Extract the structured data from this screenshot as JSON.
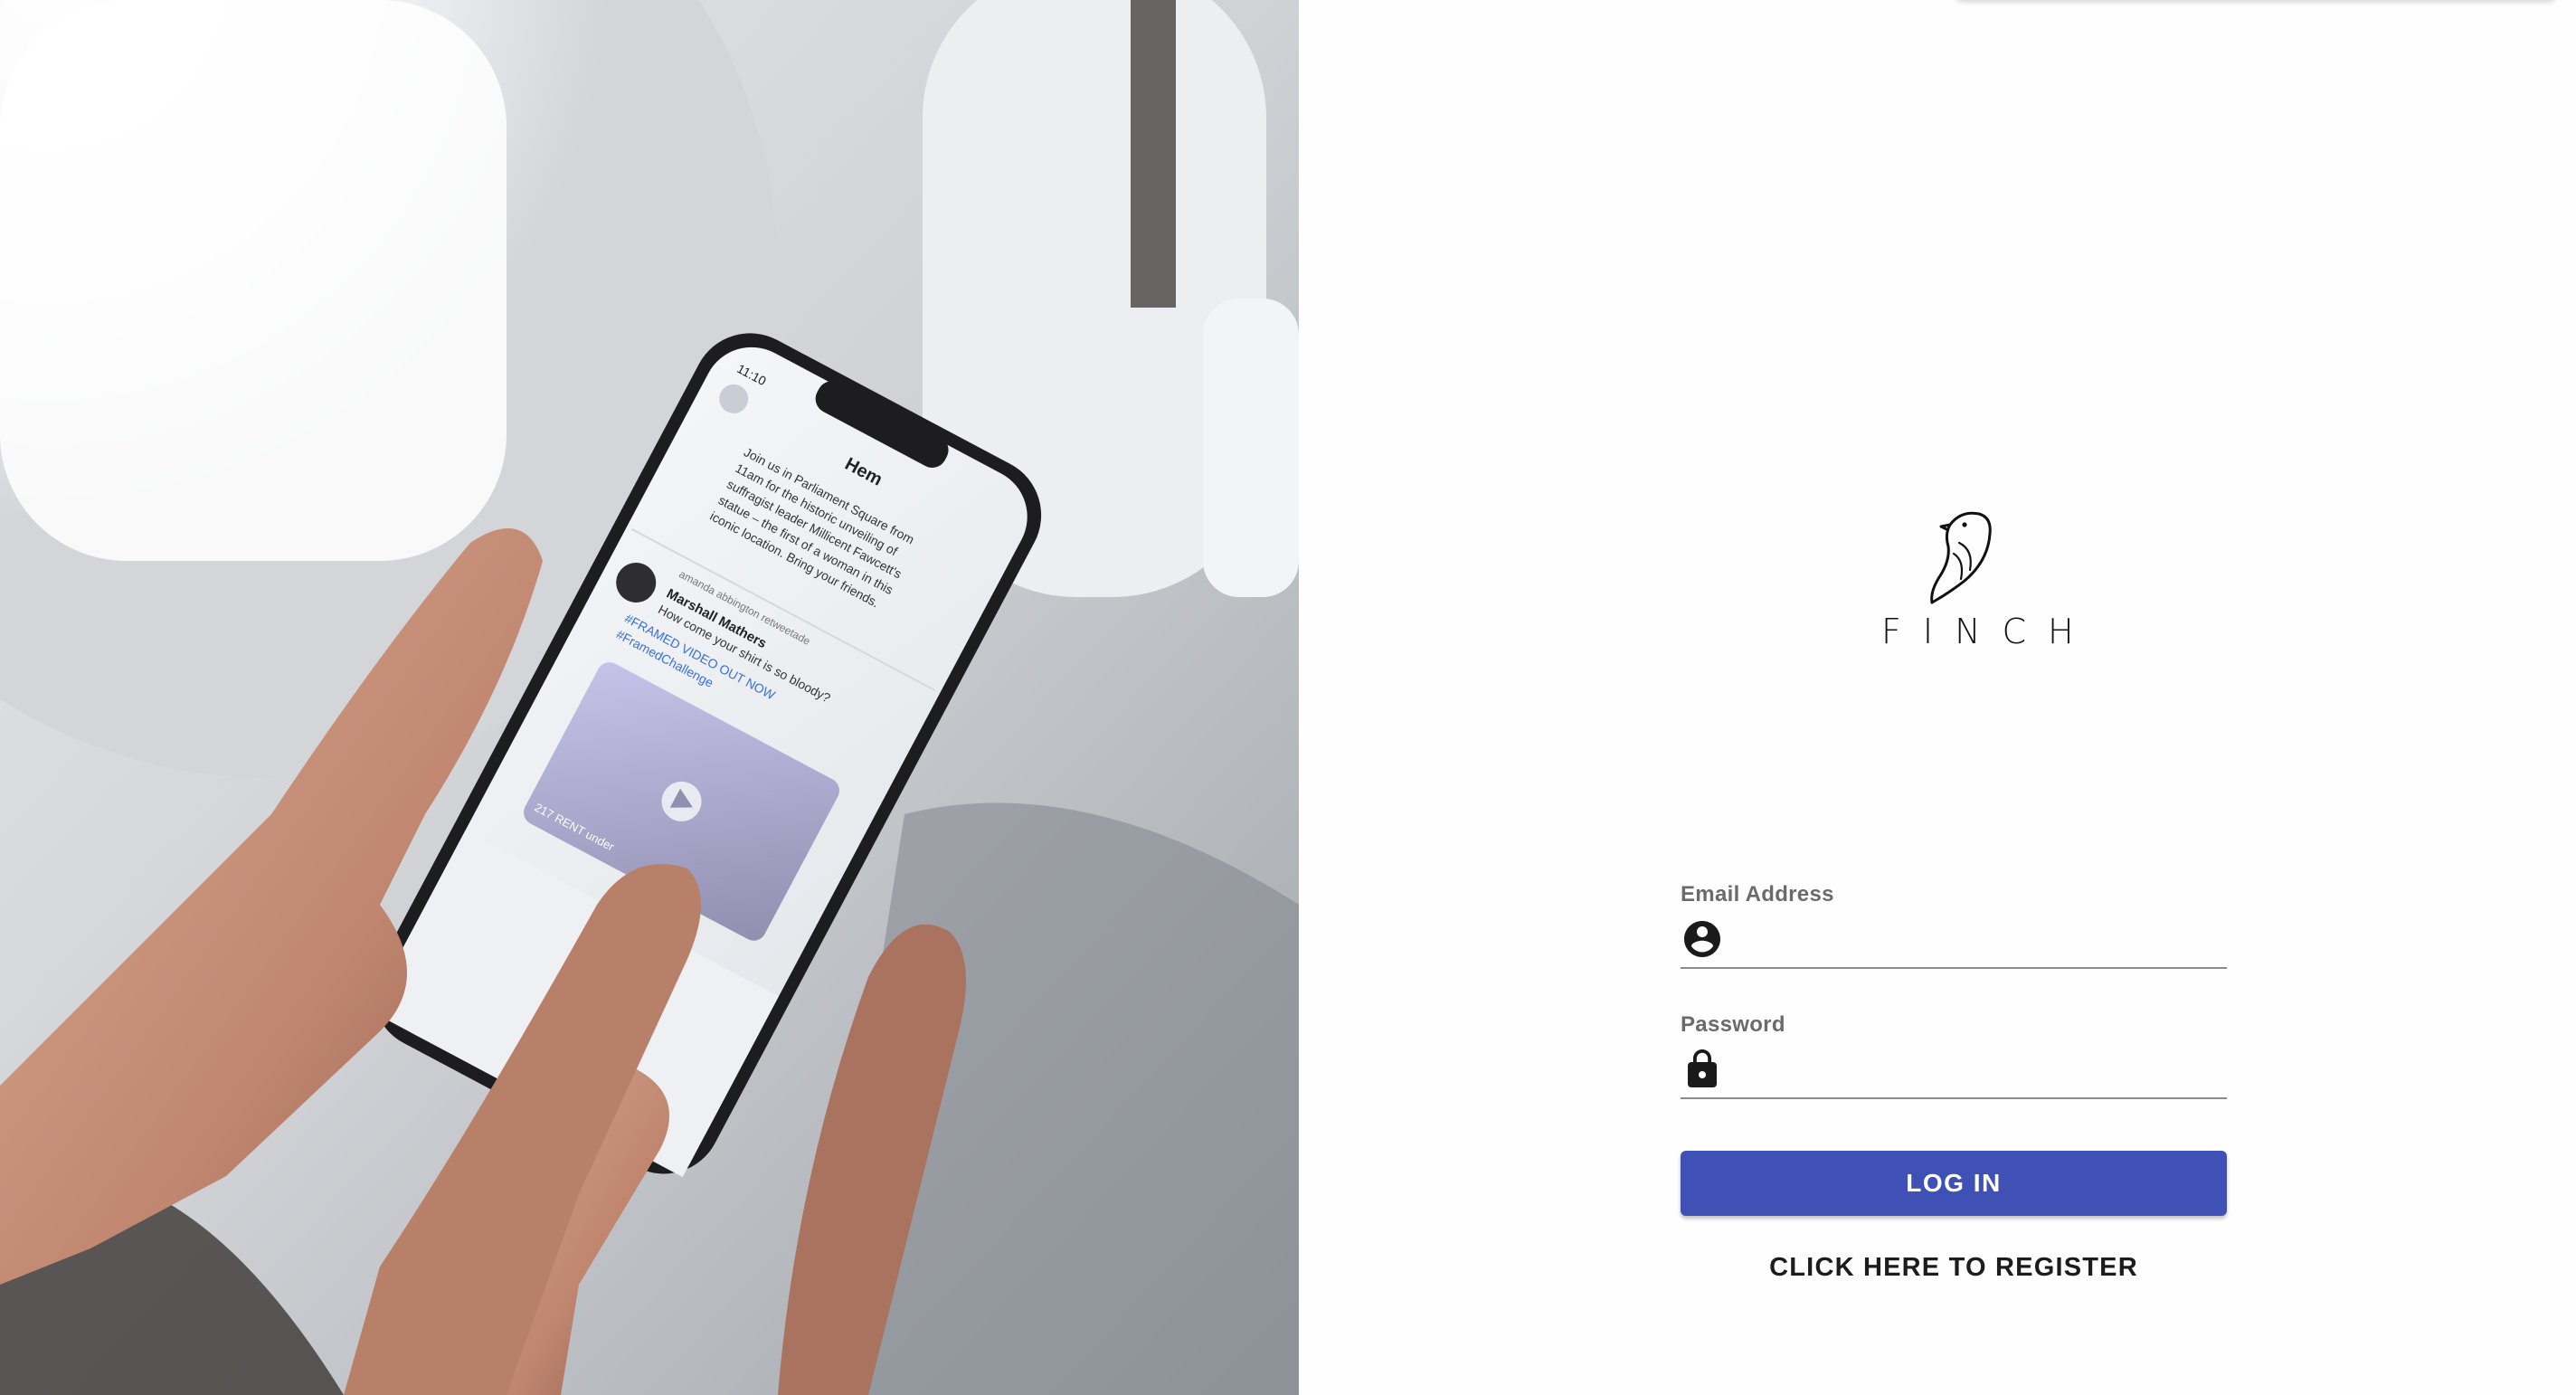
{
  "hero_image": {
    "alt": "hand holding phone",
    "phone_screen": {
      "time": "11:10",
      "header": "Hem",
      "post_text_line1": "Join us in Parliament Square from",
      "post_text_line2": "11am for the historic unveiling of",
      "post_text_line3": "suffragist leader Millicent Fawcett's",
      "post_text_line4": "statue – the first of a woman in this",
      "post_text_line5": "iconic location. Bring your friends.",
      "retweet_label": "amanda abbington retweetade",
      "author": "Marshall Mathers",
      "tweet_line1": "How come your shirt is so bloody?",
      "tweet_line2": "#FRAMED VIDEO OUT NOW",
      "tweet_line3": "#FramedChallenge",
      "video_caption": "217 RENT under"
    }
  },
  "logo": {
    "text": "FINCH",
    "icon": "finch-bird-icon"
  },
  "form": {
    "email": {
      "label": "Email Address",
      "value": "",
      "icon": "account-circle-icon"
    },
    "password": {
      "label": "Password",
      "value": "",
      "icon": "lock-icon"
    },
    "login_button_label": "LOG IN",
    "register_link_label": "CLICK HERE TO REGISTER"
  },
  "colors": {
    "primary": "#3f51b5",
    "label": "#6b6b6b",
    "underline": "#8a8a8a",
    "text": "#1c1c1c"
  }
}
